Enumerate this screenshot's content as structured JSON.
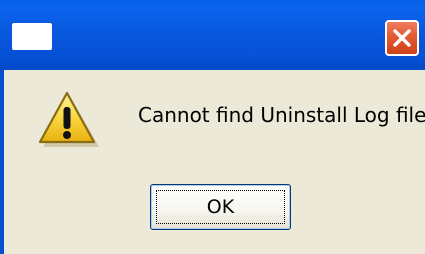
{
  "dialog": {
    "title": "",
    "message": "Cannot find Uninstall Log file",
    "icon": "warning-icon",
    "ok_label": "OK"
  },
  "icons": {
    "title_app": "window-icon",
    "close": "close-icon"
  },
  "colors": {
    "titlebar": "#0958df",
    "close_button": "#e35a33",
    "dialog_background": "#ece9d8",
    "warning_yellow": "#f2c81f",
    "ok_border": "#003c74"
  }
}
